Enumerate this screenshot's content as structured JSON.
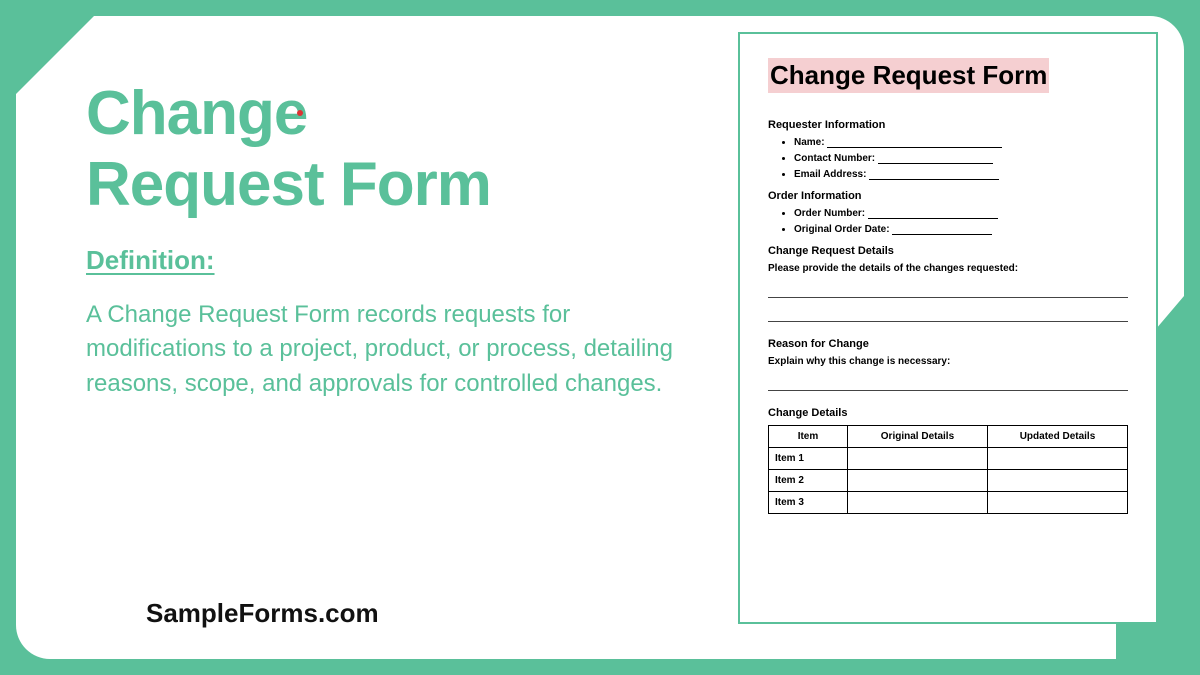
{
  "title_line1": "Change",
  "title_line2": "Request Form",
  "definition_label": "Definition:",
  "definition_body": "A Change Request Form records requests for modifications to a project, product, or process, detailing reasons, scope, and approvals for controlled changes.",
  "brand": "SampleForms.com",
  "form": {
    "title": "Change Request Form",
    "sections": {
      "requester_info": {
        "heading": "Requester Information",
        "fields": [
          "Name:",
          "Contact Number:",
          "Email Address:"
        ]
      },
      "order_info": {
        "heading": "Order Information",
        "fields": [
          "Order Number:",
          "Original Order Date:"
        ]
      },
      "change_request_details": {
        "heading": "Change Request Details",
        "instruction": "Please provide the details of the changes requested:"
      },
      "reason": {
        "heading": "Reason for Change",
        "instruction": "Explain why this change is necessary:"
      },
      "change_details": {
        "heading": "Change Details",
        "columns": [
          "Item",
          "Original Details",
          "Updated Details"
        ],
        "rows": [
          "Item 1",
          "Item 2",
          "Item 3"
        ]
      }
    }
  }
}
